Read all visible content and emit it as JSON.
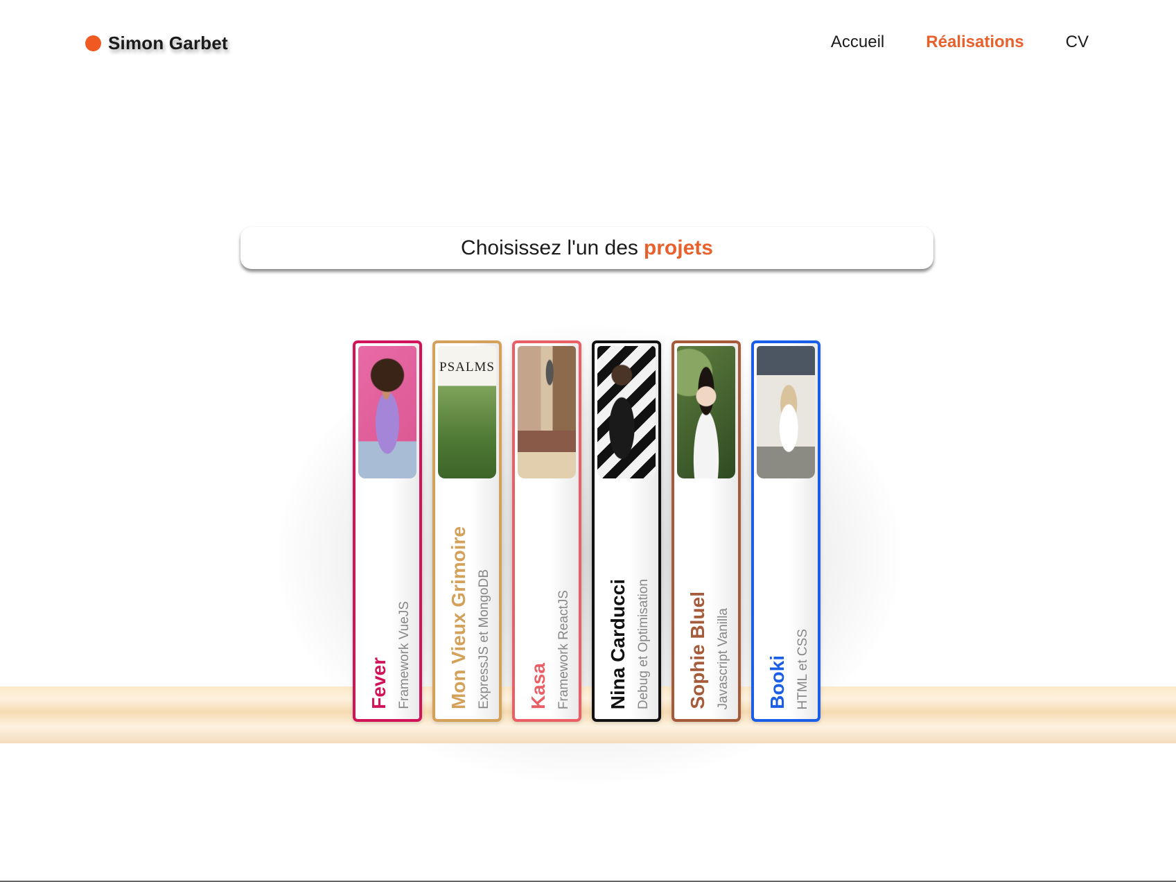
{
  "header": {
    "logo_text": "Simon Garbet",
    "nav": [
      {
        "label": "Accueil",
        "active": false
      },
      {
        "label": "Réalisations",
        "active": true
      },
      {
        "label": "CV",
        "active": false
      }
    ]
  },
  "banner": {
    "text": "Choisissez l'un des",
    "accent": "projets"
  },
  "colors": {
    "accent": "#e8602c",
    "logo_dot": "#f05a22"
  },
  "books": [
    {
      "title": "Fever",
      "subtitle": "Framework VueJS",
      "color": "#d1145a",
      "cover": "woman-portrait-pink-background"
    },
    {
      "title": "Mon Vieux Grimoire",
      "subtitle": "ExpressJS et MongoDB",
      "color": "#d4a15a",
      "cover": "psalms-book-cover",
      "cover_text": "PSALMS"
    },
    {
      "title": "Kasa",
      "subtitle": "Framework ReactJS",
      "color": "#ea5f66",
      "cover": "apartment-interior"
    },
    {
      "title": "Nina Carducci",
      "subtitle": "Debug et Optimisation",
      "color": "#111111",
      "cover": "man-in-suit-striped-wall"
    },
    {
      "title": "Sophie Bluel",
      "subtitle": "Javascript Vanilla",
      "color": "#a55b3a",
      "cover": "woman-portrait-green-foliage"
    },
    {
      "title": "Booki",
      "subtitle": "HTML et CSS",
      "color": "#1a5ee8",
      "cover": "hotel-bedroom"
    }
  ]
}
